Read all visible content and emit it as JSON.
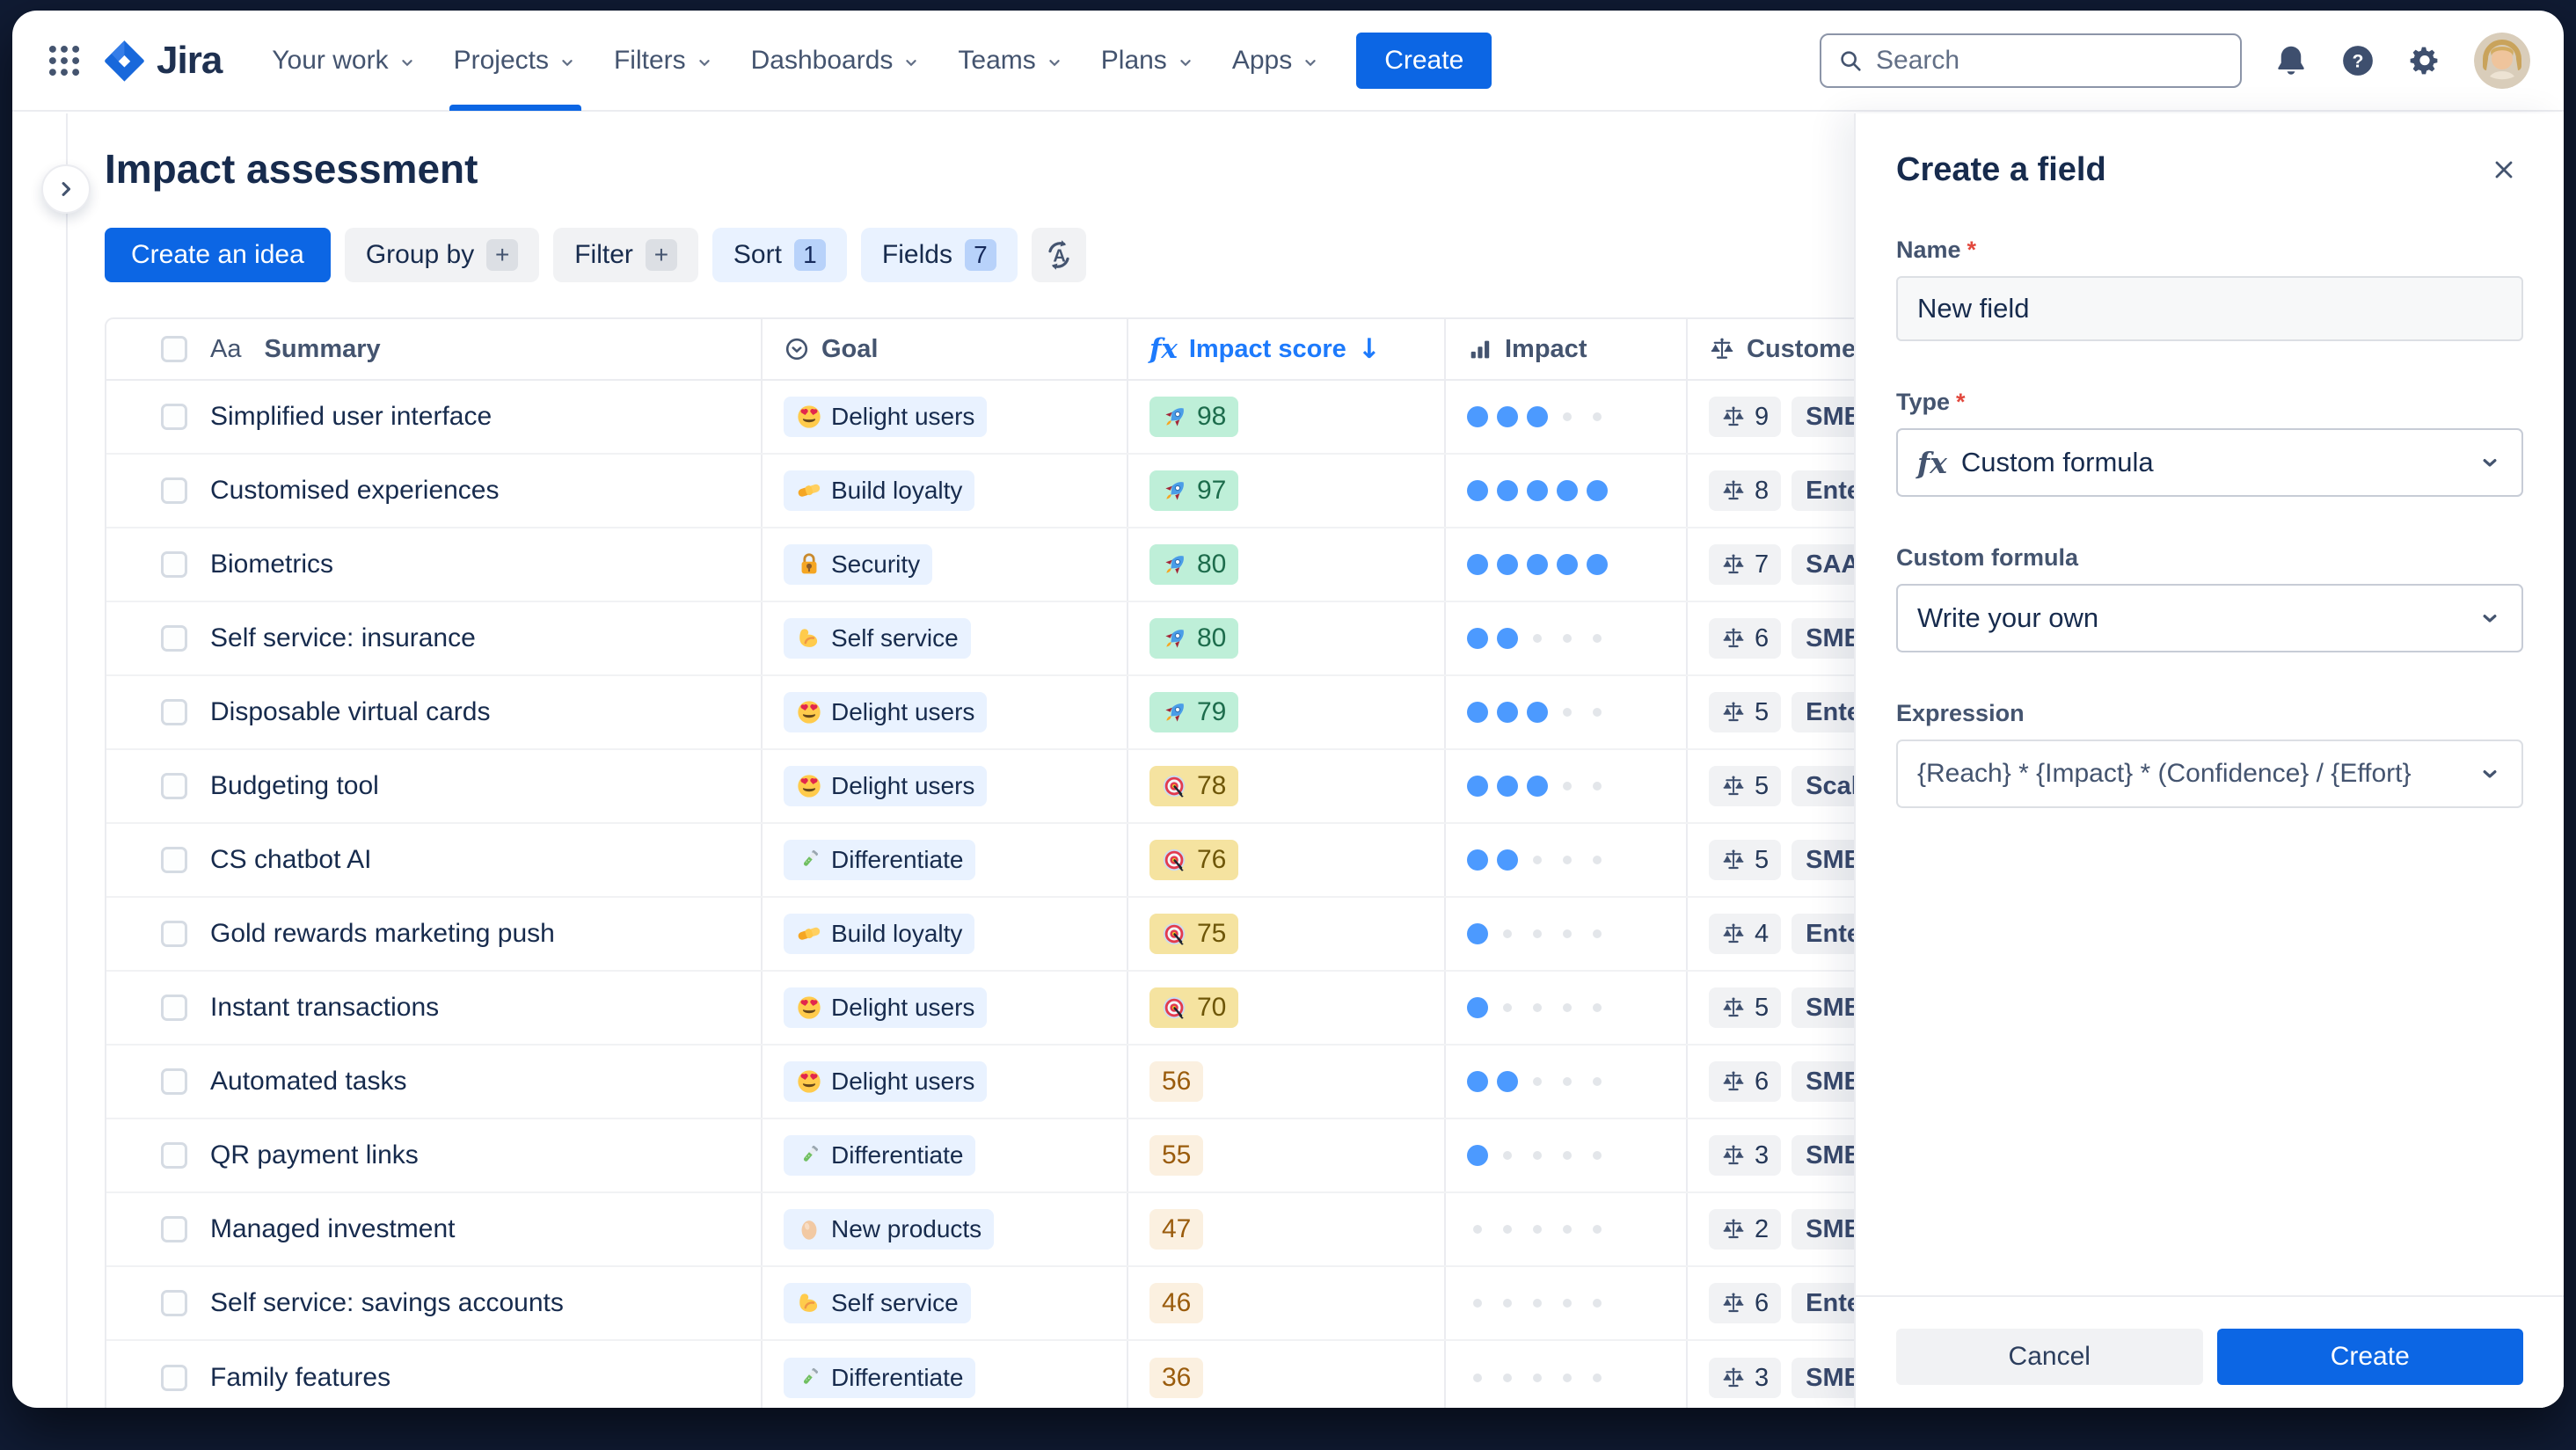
{
  "navbar": {
    "brand": "Jira",
    "items": [
      "Your work",
      "Projects",
      "Filters",
      "Dashboards",
      "Teams",
      "Plans",
      "Apps"
    ],
    "active_item": "Projects",
    "create_label": "Create",
    "search_placeholder": "Search"
  },
  "page": {
    "title": "Impact assessment"
  },
  "toolbar": {
    "create_idea": "Create an idea",
    "group_by": "Group by",
    "group_by_badge": "+",
    "filter": "Filter",
    "filter_badge": "+",
    "sort": "Sort",
    "sort_badge": "1",
    "fields": "Fields",
    "fields_badge": "7"
  },
  "table": {
    "columns": {
      "summary": "Summary",
      "summary_icon": "Aa",
      "goal": "Goal",
      "impact_score": "Impact score",
      "impact_score_icon": "fx",
      "impact_score_sort": "↓",
      "impact": "Impact",
      "customer": "Customers"
    },
    "rows": [
      {
        "summary": "Simplified user interface",
        "goal": {
          "emoji": "heart-eyes",
          "label": "Delight users"
        },
        "impact_score": {
          "value": "98",
          "emoji": "rocket",
          "tone": "green"
        },
        "impact_dots": 3,
        "customer": {
          "count": "9",
          "segment": "SMB"
        }
      },
      {
        "summary": "Customised experiences",
        "goal": {
          "emoji": "handshake",
          "label": "Build loyalty"
        },
        "impact_score": {
          "value": "97",
          "emoji": "rocket",
          "tone": "green"
        },
        "impact_dots": 5,
        "customer": {
          "count": "8",
          "segment": "Enter"
        }
      },
      {
        "summary": "Biometrics",
        "goal": {
          "emoji": "lock",
          "label": "Security"
        },
        "impact_score": {
          "value": "80",
          "emoji": "rocket",
          "tone": "green"
        },
        "impact_dots": 5,
        "customer": {
          "count": "7",
          "segment": "SAAS"
        }
      },
      {
        "summary": "Self service: insurance",
        "goal": {
          "emoji": "muscle",
          "label": "Self service"
        },
        "impact_score": {
          "value": "80",
          "emoji": "rocket",
          "tone": "green"
        },
        "impact_dots": 2,
        "customer": {
          "count": "6",
          "segment": "SMB"
        }
      },
      {
        "summary": "Disposable virtual cards",
        "goal": {
          "emoji": "heart-eyes",
          "label": "Delight users"
        },
        "impact_score": {
          "value": "79",
          "emoji": "rocket",
          "tone": "green"
        },
        "impact_dots": 3,
        "customer": {
          "count": "5",
          "segment": "Enterp"
        }
      },
      {
        "summary": "Budgeting tool",
        "goal": {
          "emoji": "heart-eyes",
          "label": "Delight users"
        },
        "impact_score": {
          "value": "78",
          "emoji": "target",
          "tone": "yellow"
        },
        "impact_dots": 3,
        "customer": {
          "count": "5",
          "segment": "Scale"
        }
      },
      {
        "summary": "CS chatbot AI",
        "goal": {
          "emoji": "test-tube",
          "label": "Differentiate"
        },
        "impact_score": {
          "value": "76",
          "emoji": "target",
          "tone": "yellow"
        },
        "impact_dots": 2,
        "customer": {
          "count": "5",
          "segment": "SMB"
        }
      },
      {
        "summary": "Gold rewards marketing push",
        "goal": {
          "emoji": "handshake",
          "label": "Build loyalty"
        },
        "impact_score": {
          "value": "75",
          "emoji": "target",
          "tone": "yellow"
        },
        "impact_dots": 1,
        "customer": {
          "count": "4",
          "segment": "Enter"
        }
      },
      {
        "summary": "Instant transactions",
        "goal": {
          "emoji": "heart-eyes",
          "label": "Delight users"
        },
        "impact_score": {
          "value": "70",
          "emoji": "target",
          "tone": "yellow"
        },
        "impact_dots": 1,
        "customer": {
          "count": "5",
          "segment": "SMB"
        }
      },
      {
        "summary": "Automated tasks",
        "goal": {
          "emoji": "heart-eyes",
          "label": "Delight users"
        },
        "impact_score": {
          "value": "56",
          "emoji": null,
          "tone": "cream"
        },
        "impact_dots": 2,
        "customer": {
          "count": "6",
          "segment": "SMB"
        }
      },
      {
        "summary": "QR payment links",
        "goal": {
          "emoji": "test-tube",
          "label": "Differentiate"
        },
        "impact_score": {
          "value": "55",
          "emoji": null,
          "tone": "cream"
        },
        "impact_dots": 1,
        "customer": {
          "count": "3",
          "segment": "SMB"
        }
      },
      {
        "summary": "Managed investment",
        "goal": {
          "emoji": "egg",
          "label": "New products"
        },
        "impact_score": {
          "value": "47",
          "emoji": null,
          "tone": "cream"
        },
        "impact_dots": 0,
        "customer": {
          "count": "2",
          "segment": "SMB"
        }
      },
      {
        "summary": "Self service: savings accounts",
        "goal": {
          "emoji": "muscle",
          "label": "Self service"
        },
        "impact_score": {
          "value": "46",
          "emoji": null,
          "tone": "cream"
        },
        "impact_dots": 0,
        "customer": {
          "count": "6",
          "segment": "Enter"
        }
      },
      {
        "summary": "Family features",
        "goal": {
          "emoji": "test-tube",
          "label": "Differentiate"
        },
        "impact_score": {
          "value": "36",
          "emoji": null,
          "tone": "cream"
        },
        "impact_dots": 0,
        "customer": {
          "count": "3",
          "segment": "SMB"
        }
      }
    ]
  },
  "panel": {
    "title": "Create a field",
    "name_label": "Name",
    "required_mark": "*",
    "name_value": "New field",
    "type_label": "Type",
    "type_icon": "fx",
    "type_value": "Custom formula",
    "custom_formula_label": "Custom formula",
    "custom_formula_value": "Write your own",
    "expression_label": "Expression",
    "expression_value": "{Reach} * {Impact} * (Confidence} / {Effort}",
    "cancel_label": "Cancel",
    "create_label": "Create"
  },
  "colors": {
    "accent": "#0C66E4",
    "selected_chip_bg": "#E9F2FF",
    "score_green_bg": "#BEEFD8",
    "score_yellow_bg": "#F5E3A0",
    "score_cream_bg": "#FBF0E0",
    "impact_dot": "#4C9AFF"
  }
}
